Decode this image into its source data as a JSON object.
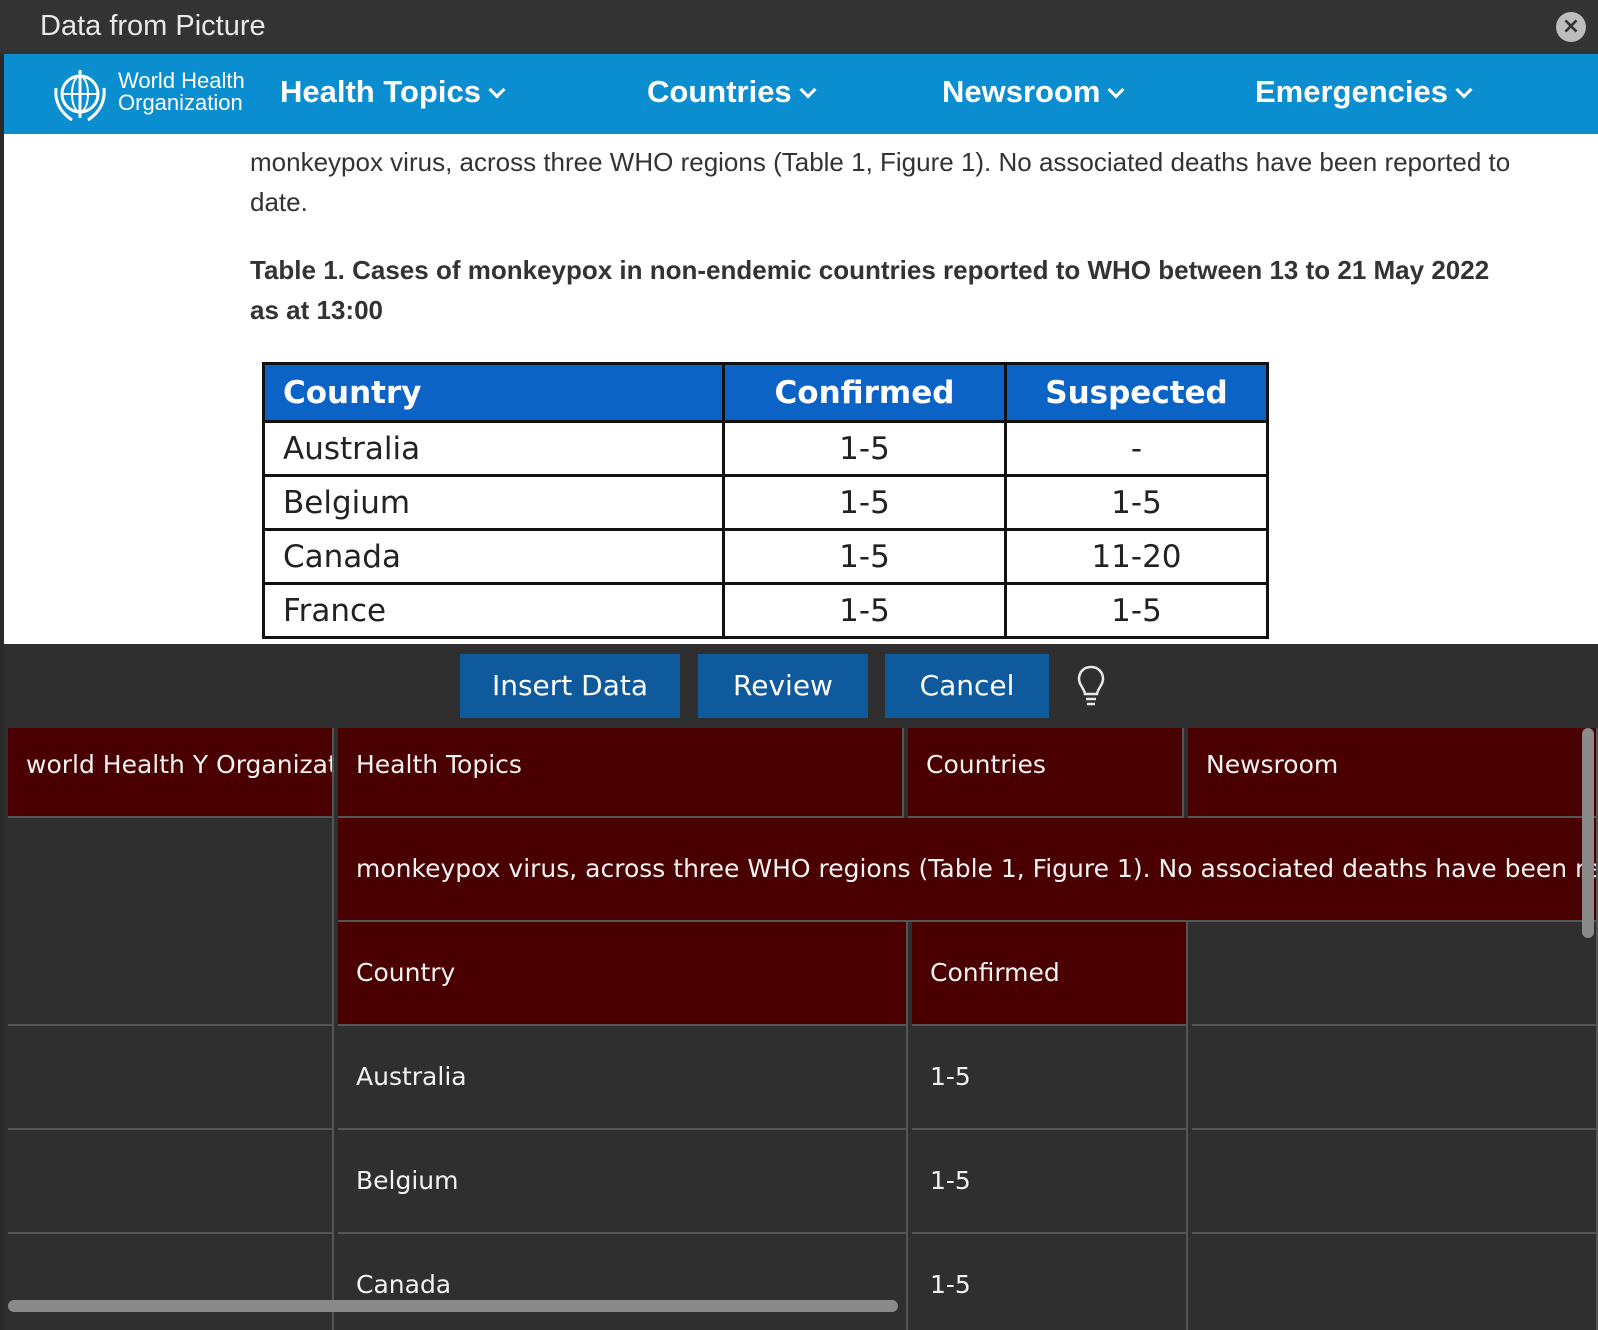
{
  "dialog": {
    "title": "Data from Picture",
    "close_icon": "close-icon"
  },
  "picture": {
    "org_name_line1": "World Health",
    "org_name_line2": "Organization",
    "nav": [
      "Health Topics",
      "Countries",
      "Newsroom",
      "Emergencies"
    ],
    "article_text": "monkeypox virus, across three WHO regions (Table 1, Figure 1). No associated deaths have been reported to date.",
    "table_caption": "Table 1. Cases of monkeypox in non-endemic countries reported to WHO between 13 to 21 May 2022 as at 13:00",
    "table": {
      "headers": [
        "Country",
        "Confirmed",
        "Suspected"
      ],
      "rows": [
        [
          "Australia",
          "1-5",
          "-"
        ],
        [
          "Belgium",
          "1-5",
          "1-5"
        ],
        [
          "Canada",
          "1-5",
          "11-20"
        ],
        [
          "France",
          "1-5",
          "1-5"
        ]
      ]
    },
    "colors": {
      "nav_bg": "#0b8ed0",
      "table_header_bg": "#0b63c5"
    }
  },
  "actions": {
    "insert_label": "Insert Data",
    "review_label": "Review",
    "cancel_label": "Cancel",
    "tip_icon": "lightbulb-icon"
  },
  "grid": {
    "rows": [
      [
        "world Health Y Organization",
        "Health Topics",
        "Countries",
        "Newsroom"
      ],
      [
        "",
        "monkeypox virus, across three WHO regions (Table 1, Figure 1). No associated deaths have been reported to date. Tab"
      ],
      [
        "",
        "Country",
        "Confirmed",
        ""
      ],
      [
        "",
        "Australia",
        "1-5",
        ""
      ],
      [
        "",
        "Belgium",
        "1-5",
        ""
      ],
      [
        "",
        "Canada",
        "1-5",
        ""
      ]
    ],
    "highlight_color": "#4a0000"
  }
}
